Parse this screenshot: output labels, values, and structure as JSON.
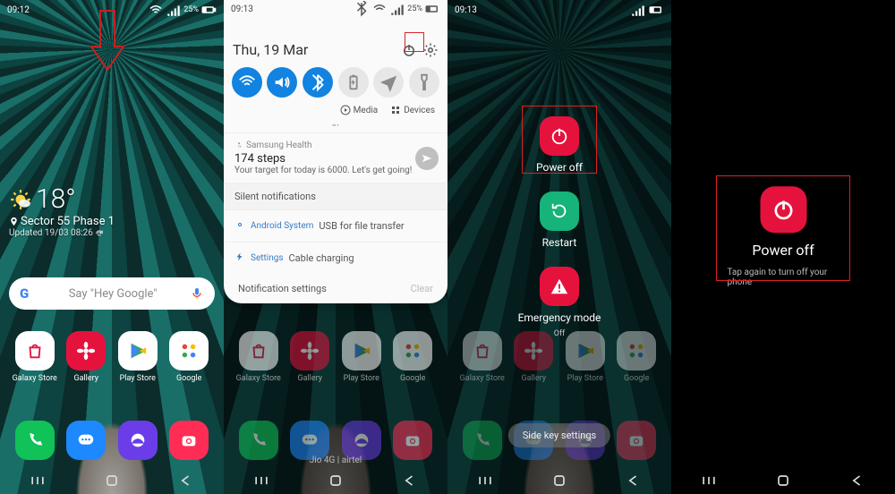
{
  "screen1": {
    "status_time": "09:12",
    "status_right": "25%",
    "weather": {
      "temp": "18°",
      "location": "Sector 55 Phase 1",
      "updated": "Updated 19/03 08:26"
    },
    "search_placeholder": "Say \"Hey Google\"",
    "apps": [
      {
        "label": "Galaxy Store",
        "color": "#fff",
        "fg": "#e5123d",
        "glyph": "bag"
      },
      {
        "label": "Gallery",
        "color": "#e5123d",
        "glyph": "flower"
      },
      {
        "label": "Play Store",
        "color": "#fff",
        "glyph": "play"
      },
      {
        "label": "Google",
        "color": "#fff",
        "glyph": "grid"
      }
    ],
    "dock": [
      {
        "color": "#10c257",
        "glyph": "phone"
      },
      {
        "color": "#1e88ff",
        "glyph": "msg"
      },
      {
        "color": "#6a3de8",
        "glyph": "browser"
      },
      {
        "color": "#ff2d55",
        "glyph": "camera"
      }
    ]
  },
  "screen2": {
    "status_time": "09:13",
    "status_right": "25%",
    "date": "Thu, 19 Mar",
    "toggles": [
      {
        "name": "wifi",
        "on": true,
        "glyph": "wifi"
      },
      {
        "name": "sound",
        "on": true,
        "glyph": "sound"
      },
      {
        "name": "bt",
        "on": true,
        "glyph": "bt"
      },
      {
        "name": "saver",
        "on": false,
        "glyph": "batt"
      },
      {
        "name": "plane",
        "on": false,
        "glyph": "plane"
      },
      {
        "name": "torch",
        "on": false,
        "glyph": "torch"
      }
    ],
    "media_label": "Media",
    "devices_label": "Devices",
    "notif_health": {
      "source": "Samsung Health",
      "title": "174 steps",
      "message": "Your target for today is 6000. Let's get going!"
    },
    "silent_header": "Silent notifications",
    "silent_rows": [
      {
        "source": "Android System",
        "text": "USB for file transfer"
      },
      {
        "source": "Settings",
        "text": "Cable charging"
      }
    ],
    "footer_settings": "Notification settings",
    "footer_clear": "Clear",
    "carrier": "Jio 4G | airtel"
  },
  "screen3": {
    "status_time": "09:13",
    "options": [
      {
        "name": "poweroff",
        "label": "Power off",
        "color": "#e5123d",
        "glyph": "power"
      },
      {
        "name": "restart",
        "label": "Restart",
        "color": "#16b37a",
        "glyph": "restart"
      },
      {
        "name": "emergency",
        "label": "Emergency mode",
        "sub": "Off",
        "color": "#e5123d",
        "glyph": "alert"
      }
    ],
    "side_key": "Side key settings"
  },
  "screen4": {
    "title": "Power off",
    "message": "Tap again to turn off your phone"
  }
}
